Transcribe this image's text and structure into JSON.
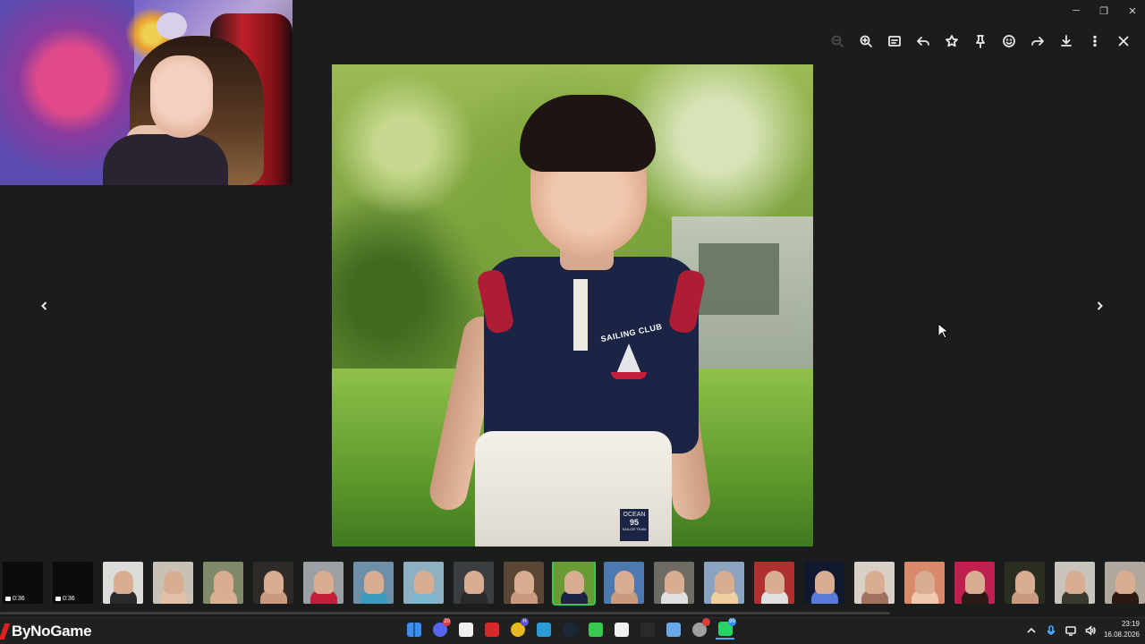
{
  "window": {
    "controls": {
      "minimize": "─",
      "maximize": "❐",
      "close": "✕"
    }
  },
  "toolbar": {
    "buttons": [
      {
        "icon": "zoom-out-icon",
        "state": "disabled"
      },
      {
        "icon": "zoom-in-icon"
      },
      {
        "icon": "caption-icon"
      },
      {
        "icon": "reply-icon"
      },
      {
        "icon": "star-icon"
      },
      {
        "icon": "pin-icon"
      },
      {
        "icon": "emoji-react-icon"
      },
      {
        "icon": "forward-icon"
      },
      {
        "icon": "download-icon"
      },
      {
        "icon": "more-options-icon"
      },
      {
        "icon": "close-icon"
      }
    ]
  },
  "photo": {
    "shirt_text": "SAILING CLUB",
    "tag_line1": "OCEAN",
    "tag_number": "95",
    "tag_line2": "SAILOR TEAM"
  },
  "thumbnails": [
    {
      "kind": "video",
      "duration": "0:36",
      "bg": "#0b0b0b"
    },
    {
      "kind": "video",
      "duration": "0:36",
      "bg": "#0b0b0b"
    },
    {
      "kind": "image",
      "bg": "#dcdcd8",
      "fig": "#2a2a2a"
    },
    {
      "kind": "image",
      "bg": "#c9c2b4",
      "fig": "#e0c0a8"
    },
    {
      "kind": "image",
      "bg": "#7e8a6a",
      "fig": "#d9b094"
    },
    {
      "kind": "image",
      "bg": "#2e2a28",
      "fig": "#c99a7e"
    },
    {
      "kind": "image",
      "bg": "#9aa0a4",
      "fig": "#c41e3a"
    },
    {
      "kind": "image",
      "bg": "#6d8fa8",
      "fig": "#3f9abf"
    },
    {
      "kind": "image",
      "bg": "#8fb0c2",
      "fig": "#7fb6cf"
    },
    {
      "kind": "image",
      "bg": "#3a3e40",
      "fig": "#2a2a2a"
    },
    {
      "kind": "image",
      "bg": "#5a4634",
      "fig": "#c99a7e"
    },
    {
      "kind": "image",
      "bg": "#6a9a34",
      "fig": "#1c2446",
      "selected": true
    },
    {
      "kind": "image",
      "bg": "#4c7ab0",
      "fig": "#c99a7e"
    },
    {
      "kind": "image",
      "bg": "#6e6a64",
      "fig": "#e0e0e0"
    },
    {
      "kind": "image",
      "bg": "#8aa4c0",
      "fig": "#f0d0a0"
    },
    {
      "kind": "image",
      "bg": "#b03030",
      "fig": "#e0e0e0"
    },
    {
      "kind": "image",
      "bg": "#101830",
      "fig": "#5a7ad8"
    },
    {
      "kind": "image",
      "bg": "#d8d0c4",
      "fig": "#a07060"
    },
    {
      "kind": "image",
      "bg": "#d88a6a",
      "fig": "#f0c8ae"
    },
    {
      "kind": "image",
      "bg": "#c02050",
      "fig": "#2a1a18"
    },
    {
      "kind": "image",
      "bg": "#2a2e20",
      "fig": "#c99a7e"
    },
    {
      "kind": "image",
      "bg": "#c8c4bc",
      "fig": "#3a3a30"
    },
    {
      "kind": "image",
      "bg": "#b0a89c",
      "fig": "#2a1a12"
    }
  ],
  "brand": {
    "name": "ByNoGame"
  },
  "taskbar": {
    "apps": [
      {
        "icon": "windows-start-icon",
        "color": "#3a8ef0"
      },
      {
        "icon": "discord-icon",
        "color": "#5865f2",
        "badge": "20",
        "badge_color": "#d83c3c"
      },
      {
        "icon": "microsoft-store-icon",
        "color": "#f0f0f0"
      },
      {
        "icon": "app-red-icon",
        "color": "#d42a2a"
      },
      {
        "icon": "chrome-icon",
        "color": "#e8b820",
        "badge": "H",
        "badge_color": "#5a4fd0"
      },
      {
        "icon": "file-app-icon",
        "color": "#2a9ad8"
      },
      {
        "icon": "steam-icon",
        "color": "#1b2838"
      },
      {
        "icon": "play-app-icon",
        "color": "#3ac850"
      },
      {
        "icon": "capcut-icon",
        "color": "#f0f0f0"
      },
      {
        "icon": "epic-games-icon",
        "color": "#2a2a2a"
      },
      {
        "icon": "riot-client-icon",
        "color": "#6aa8e8"
      },
      {
        "icon": "settings-app-icon",
        "color": "#a0a0a0",
        "badge": "",
        "badge_color": "#d83c3c"
      },
      {
        "icon": "whatsapp-icon",
        "color": "#25d366",
        "badge": "99",
        "badge_color": "#3a8ef0",
        "active": true
      }
    ]
  },
  "tray": {
    "icons": [
      "chevron-up-icon",
      "microphone-icon",
      "display-icon",
      "volume-icon"
    ]
  },
  "clock": {
    "time": "23:19",
    "date": "16.08.2026"
  }
}
